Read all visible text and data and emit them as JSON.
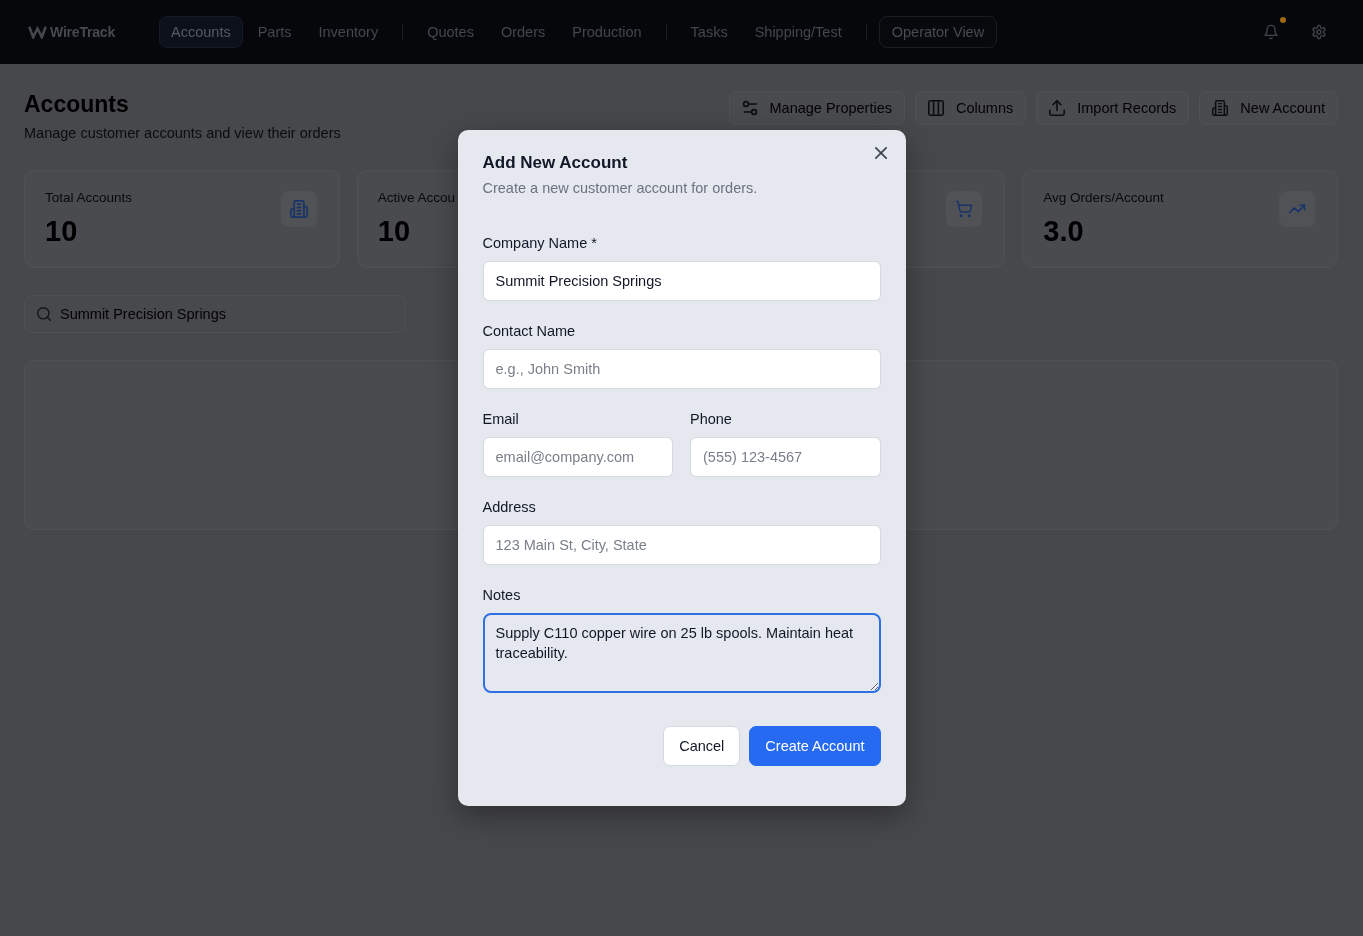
{
  "nav": {
    "logo": "WireTrack",
    "groups": [
      [
        {
          "label": "Accounts",
          "selected": true
        },
        {
          "label": "Parts",
          "selected": false
        },
        {
          "label": "Inventory",
          "selected": false
        }
      ],
      [
        {
          "label": "Quotes",
          "selected": false
        },
        {
          "label": "Orders",
          "selected": false
        },
        {
          "label": "Production",
          "selected": false
        }
      ],
      [
        {
          "label": "Tasks",
          "selected": false
        },
        {
          "label": "Shipping/Test",
          "selected": false
        }
      ]
    ],
    "operator_button": "Operator View",
    "notifications": {
      "unread": true
    }
  },
  "header": {
    "title": "Accounts",
    "subtitle": "Manage customer accounts and view their orders",
    "actions": [
      "Manage Properties",
      "Columns",
      "Import Records",
      "New Account"
    ]
  },
  "stats": [
    {
      "label": "Total Accounts",
      "value": "10"
    },
    {
      "label": "Active Accou",
      "value": "10"
    },
    {
      "label": "Avg Orders/Account",
      "value": "3.0"
    }
  ],
  "search": {
    "value": "Summit Precision Springs"
  },
  "dialog": {
    "title": "Add New Account",
    "subtitle": "Create a new customer account for orders.",
    "rows": [
      [
        {
          "kind": "text",
          "label": "Company Name *",
          "value": "Summit Precision Springs",
          "focused": false
        }
      ],
      [
        {
          "kind": "text",
          "label": "Contact Name",
          "placeholder": "e.g., John Smith",
          "focused": false
        }
      ],
      [
        {
          "kind": "text",
          "label": "Email",
          "placeholder": "email@company.com",
          "focused": false
        },
        {
          "kind": "text",
          "label": "Phone",
          "placeholder": "(555) 123-4567",
          "focused": false
        }
      ],
      [
        {
          "kind": "text",
          "label": "Address",
          "placeholder": "123 Main St, City, State",
          "focused": false
        }
      ],
      [
        {
          "kind": "textarea",
          "label": "Notes",
          "value": "Supply C110 copper wire on 25 lb spools. Maintain heat traceability.",
          "focused": true
        }
      ]
    ],
    "buttons": [
      {
        "kind": "secondary",
        "label": "Cancel"
      },
      {
        "kind": "primary",
        "label": "Create Account"
      }
    ]
  }
}
